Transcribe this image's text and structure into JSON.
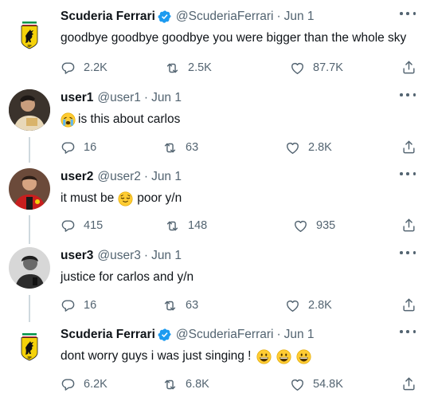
{
  "tweets": [
    {
      "name": "Scuderia Ferrari",
      "handle": "@ScuderiaFerrari",
      "date": "Jun 1",
      "verified": true,
      "text": "goodbye goodbye goodbye you were bigger than the whole sky",
      "reply_count": "2.2K",
      "retweet_count": "2.5K",
      "like_count": "87.7K"
    },
    {
      "name": "user1",
      "handle": "@user1",
      "date": "Jun 1",
      "verified": false,
      "text": "is this about carlos",
      "emoji_before": "crying-face",
      "reply_count": "16",
      "retweet_count": "63",
      "like_count": "2.8K"
    },
    {
      "name": "user2",
      "handle": "@user2",
      "date": "Jun 1",
      "verified": false,
      "text_before": "it must be",
      "emoji_middle": "relieved-face",
      "text_after": "poor y/n",
      "reply_count": "415",
      "retweet_count": "148",
      "like_count": "935"
    },
    {
      "name": "user3",
      "handle": "@user3",
      "date": "Jun 1",
      "verified": false,
      "text": "justice for carlos and y/n",
      "reply_count": "16",
      "retweet_count": "63",
      "like_count": "2.8K"
    },
    {
      "name": "Scuderia Ferrari",
      "handle": "@ScuderiaFerrari",
      "date": "Jun 1",
      "verified": true,
      "text": "dont worry guys i was just singing !",
      "emoji_after": [
        "grinning-face",
        "grinning-face",
        "grinning-face"
      ],
      "reply_count": "6.2K",
      "retweet_count": "6.8K",
      "like_count": "54.8K"
    }
  ],
  "dot_separator": "·",
  "colors": {
    "verified_blue": "#1d9bf0",
    "secondary_text": "#536471",
    "thread_line": "#cfd9de",
    "ferrari_yellow": "#f5d20a"
  }
}
